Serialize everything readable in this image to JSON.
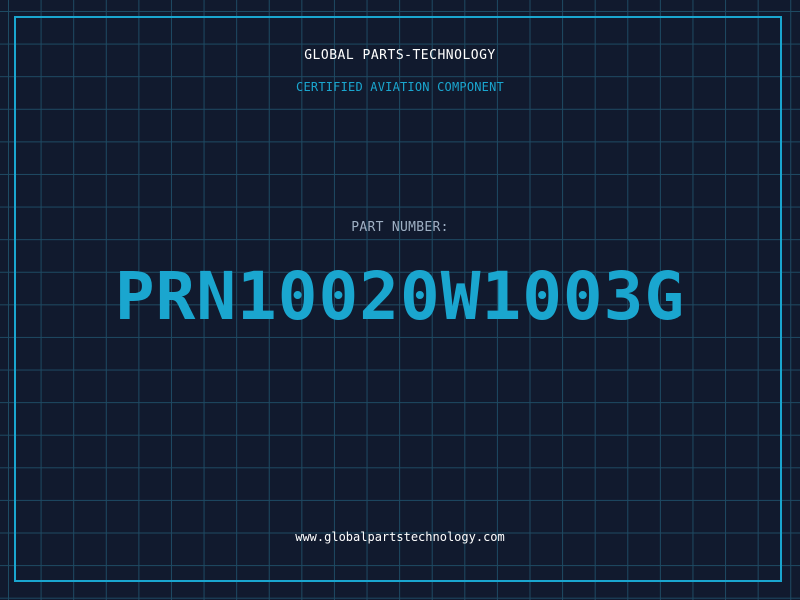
{
  "header": {
    "company": "GLOBAL PARTS-TECHNOLOGY",
    "subtitle": "CERTIFIED AVIATION COMPONENT"
  },
  "part": {
    "label": "PART NUMBER:",
    "number": "PRN10020W1003G"
  },
  "footer": {
    "website": "www.globalpartstechnology.com"
  },
  "colors": {
    "background": "#111a2e",
    "grid": "#1e4a63",
    "accent": "#1aa6cf",
    "text": "#ffffff",
    "muted": "#9fb0c4"
  }
}
